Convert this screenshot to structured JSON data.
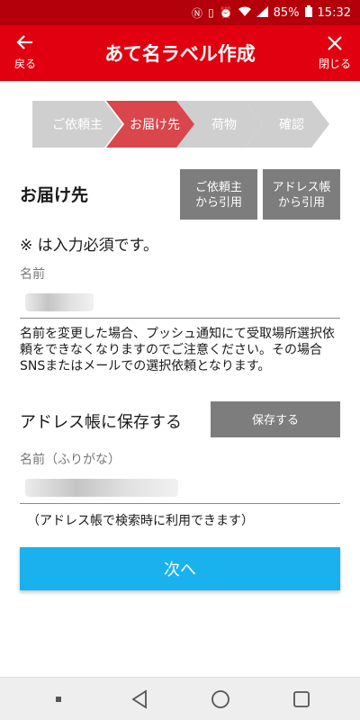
{
  "status_bar": {
    "battery": "85%",
    "time": "15:32"
  },
  "header": {
    "title": "あて名ラベル作成",
    "back_label": "戻る",
    "close_label": "閉じる"
  },
  "steps": [
    {
      "label": "ご依頼主"
    },
    {
      "label": "お届け先"
    },
    {
      "label": "荷物"
    },
    {
      "label": "確認"
    }
  ],
  "form": {
    "section_title": "お届け先",
    "sender_button": {
      "line1": "ご依頼主",
      "line2": "から引用"
    },
    "addressbook_button": {
      "line1": "アドレス帳",
      "line2": "から引用"
    },
    "required_note": "※ は入力必須です。",
    "name_label": "名前",
    "warning": "名前を変更した場合、プッシュ通知にて受取場所選択依頼をできなくなりますのでご注意ください。その場合SNSまたはメールでの選択依頼となります。",
    "save_label": "アドレス帳に保存する",
    "save_button": "保存する",
    "kana_label": "名前（ふりがな）",
    "kana_hint": "（アドレス帳で検索時に利用できます）",
    "next_button": "次へ"
  },
  "colors": {
    "header": "#e0000f",
    "status_bar": "#b4000a",
    "active_step": "#d9464b",
    "inactive_step": "#cfcfcf",
    "primary_button": "#1ab2ee",
    "gray_button": "#7d7d7d"
  },
  "icons": {
    "back": "arrow-left-icon",
    "close": "close-icon"
  }
}
